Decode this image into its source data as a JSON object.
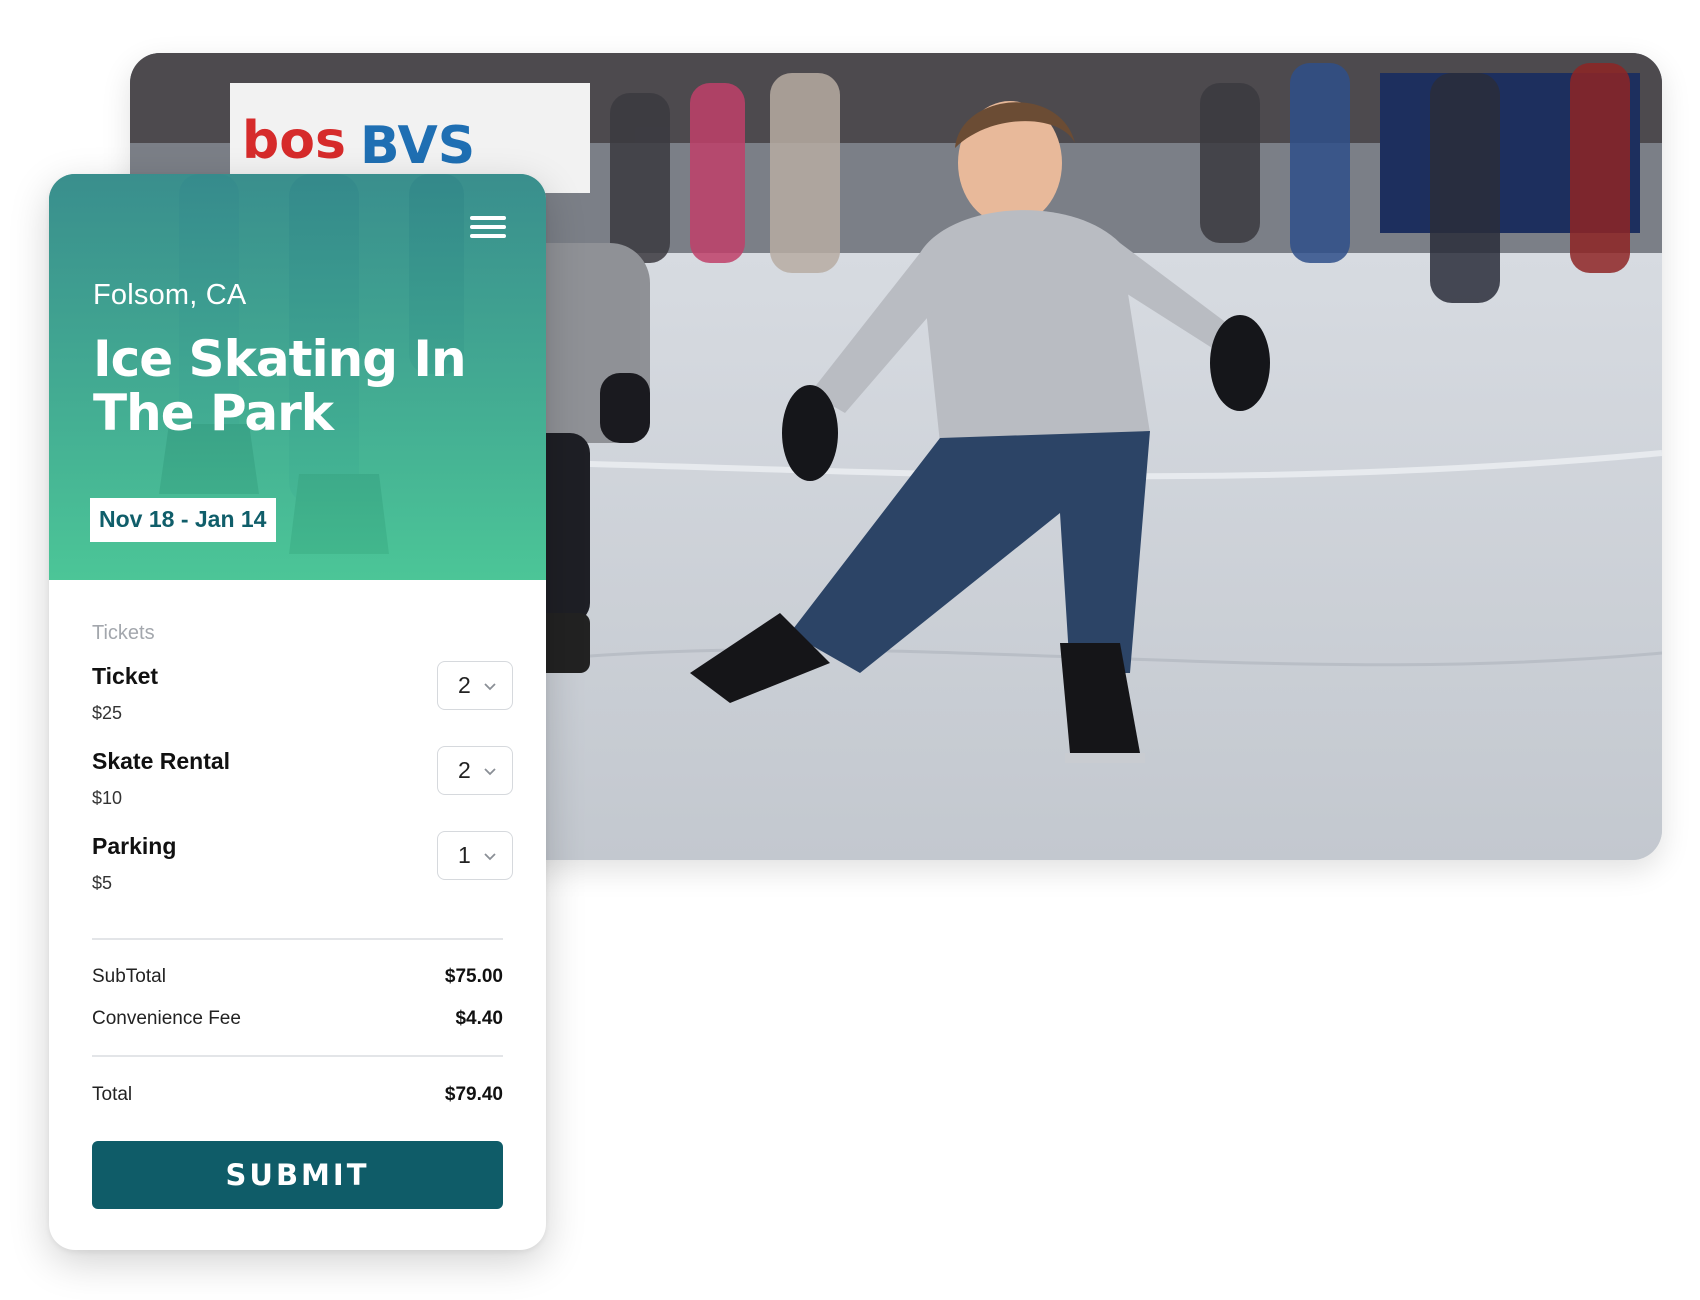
{
  "hero": {
    "location": "Folsom, CA",
    "title": "Ice Skating In The Park",
    "dates": "Nov 18 - Jan 14",
    "menu_icon": "hamburger-menu-icon"
  },
  "tickets": {
    "section_label": "Tickets",
    "items": [
      {
        "name": "Ticket",
        "price": "$25",
        "quantity": "2"
      },
      {
        "name": "Skate Rental",
        "price": "$10",
        "quantity": "2"
      },
      {
        "name": "Parking",
        "price": "$5",
        "quantity": "1"
      }
    ]
  },
  "summary": {
    "subtotal_label": "SubTotal",
    "subtotal_value": "$75.00",
    "fee_label": "Convenience Fee",
    "fee_value": "$4.40",
    "total_label": "Total",
    "total_value": "$79.40"
  },
  "actions": {
    "submit_label": "SUBMIT"
  },
  "colors": {
    "primary": "#0f5c68",
    "hero_gradient_top": "#2f8f8b",
    "hero_gradient_bottom": "#45c895"
  },
  "photo": {
    "banner_text_left": "bos",
    "banner_text_mid": "BVS"
  }
}
